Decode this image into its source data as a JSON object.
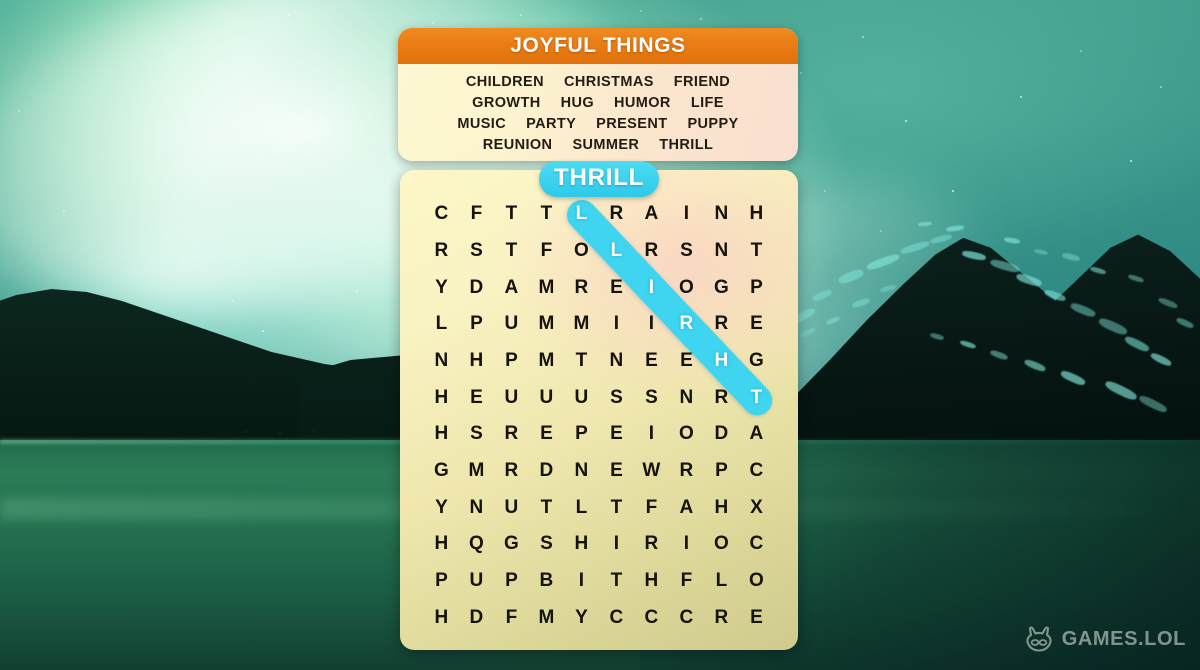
{
  "word_list": {
    "title": "JOYFUL THINGS",
    "rows": [
      [
        "CHILDREN",
        "CHRISTMAS",
        "FRIEND"
      ],
      [
        "GROWTH",
        "HUG",
        "HUMOR",
        "LIFE"
      ],
      [
        "MUSIC",
        "PARTY",
        "PRESENT",
        "PUPPY"
      ],
      [
        "REUNION",
        "SUMMER",
        "THRILL"
      ]
    ],
    "all_words": [
      "CHILDREN",
      "CHRISTMAS",
      "FRIEND",
      "GROWTH",
      "HUG",
      "HUMOR",
      "LIFE",
      "MUSIC",
      "PARTY",
      "PRESENT",
      "PUPPY",
      "REUNION",
      "SUMMER",
      "THRILL"
    ]
  },
  "found_word_pill": {
    "label": "THRILL",
    "color": "#3fd4ef"
  },
  "grid": {
    "columns": 10,
    "rows": 12,
    "letters": [
      [
        "C",
        "F",
        "T",
        "T",
        "L",
        "R",
        "A",
        "I",
        "N",
        "H"
      ],
      [
        "R",
        "S",
        "T",
        "F",
        "O",
        "L",
        "R",
        "S",
        "N",
        "T"
      ],
      [
        "Y",
        "D",
        "A",
        "M",
        "R",
        "E",
        "I",
        "O",
        "G",
        "P"
      ],
      [
        "L",
        "P",
        "U",
        "M",
        "M",
        "I",
        "I",
        "R",
        "R",
        "E"
      ],
      [
        "N",
        "H",
        "P",
        "M",
        "T",
        "N",
        "E",
        "E",
        "H",
        "G"
      ],
      [
        "H",
        "E",
        "U",
        "U",
        "U",
        "S",
        "S",
        "N",
        "R",
        "T"
      ],
      [
        "H",
        "S",
        "R",
        "E",
        "P",
        "E",
        "I",
        "O",
        "D",
        "A"
      ],
      [
        "G",
        "M",
        "R",
        "D",
        "N",
        "E",
        "W",
        "R",
        "P",
        "C"
      ],
      [
        "Y",
        "N",
        "U",
        "T",
        "L",
        "T",
        "F",
        "A",
        "H",
        "X"
      ],
      [
        "H",
        "Q",
        "G",
        "S",
        "H",
        "I",
        "R",
        "I",
        "O",
        "C"
      ],
      [
        "P",
        "U",
        "P",
        "B",
        "I",
        "T",
        "H",
        "F",
        "L",
        "O"
      ],
      [
        "H",
        "D",
        "F",
        "M",
        "Y",
        "C",
        "C",
        "C",
        "R",
        "E"
      ]
    ],
    "selection": {
      "word": "THRILL",
      "direction": "diagonal-down-right",
      "cells": [
        {
          "row": 0,
          "col": 4,
          "letter": "L"
        },
        {
          "row": 1,
          "col": 5,
          "letter": "L"
        },
        {
          "row": 2,
          "col": 6,
          "letter": "I"
        },
        {
          "row": 3,
          "col": 7,
          "letter": "R"
        },
        {
          "row": 4,
          "col": 8,
          "letter": "H"
        },
        {
          "row": 5,
          "col": 9,
          "letter": "T"
        }
      ],
      "highlight_color": "#3fd4ef"
    }
  },
  "watermark": {
    "label": "GAMES.LOL",
    "icon": "games-lol-logo-icon"
  },
  "theme": {
    "header_orange": "#e97c13",
    "card_cream": "#fcf7c8",
    "selection_cyan": "#3fd4ef",
    "letter_dark": "#16120c",
    "aurora_green": "#3e9b8c",
    "lake_green": "#2c7c57"
  }
}
